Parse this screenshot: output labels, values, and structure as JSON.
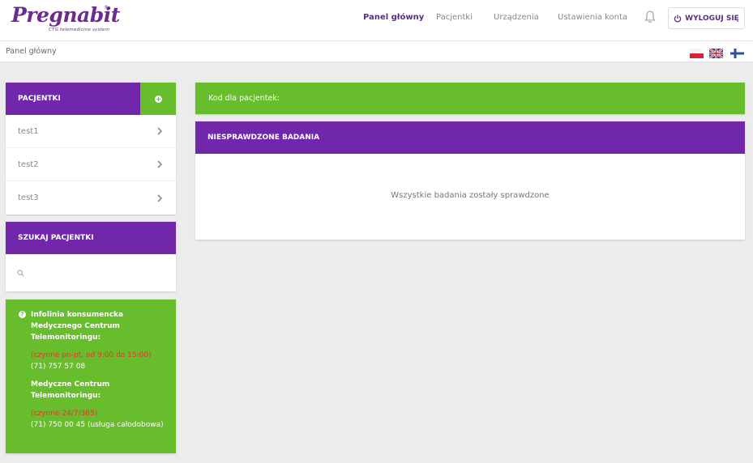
{
  "brand": {
    "name": "Pregnabit",
    "reg": "®",
    "tagline": "CTG telemedicine system"
  },
  "nav": {
    "items": [
      {
        "label": "Panel główny",
        "active": true
      },
      {
        "label": "Pacjentki",
        "active": false
      },
      {
        "label": "Urządzenia",
        "active": false
      },
      {
        "label": "Ustawienia konta",
        "active": false
      }
    ],
    "logout_label": "WYLOGUJ SIĘ"
  },
  "breadcrumb": "Panel główny",
  "languages": [
    "pl",
    "en",
    "fi"
  ],
  "patients_panel": {
    "title": "PACJENTKI",
    "items": [
      "test1",
      "test2",
      "test3"
    ]
  },
  "search_panel": {
    "title": "SZUKAJ PACJENTKI",
    "placeholder": "",
    "value": ""
  },
  "info_panel": {
    "hotline_title": "Infolinia konsumencka Medycznego Centrum Telemonitoringu:",
    "hotline_hours": "(czynne pn-pt, od 9:00 do 15:00)",
    "hotline_phone": "(71) 757 57 08",
    "center_title": "Medyczne Centrum Telemonitoringu:",
    "center_hours": "(czynne 24/7/365)",
    "center_phone": "(71) 750 00 45 (usługa całodobowa)"
  },
  "code_bar": {
    "label": "Kod dla pacjentek:"
  },
  "unchecked_panel": {
    "title": "NIESPRAWDZONE BADANIA",
    "message": "Wszystkie badania zostały sprawdzone"
  },
  "colors": {
    "purple": "#7127aa",
    "green": "#67bd2b",
    "red": "#e8342c"
  }
}
